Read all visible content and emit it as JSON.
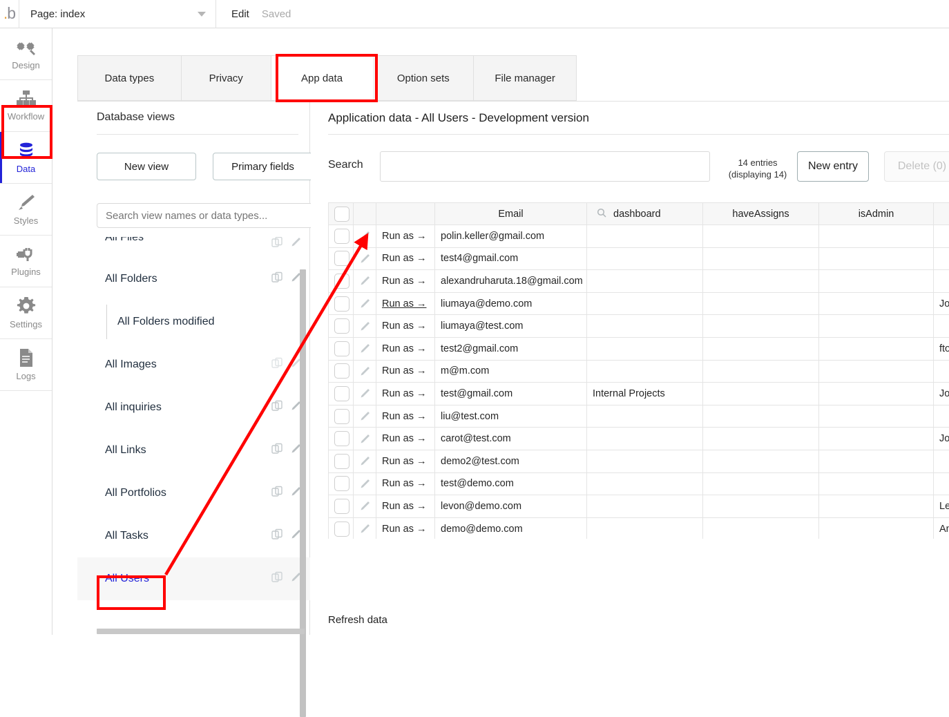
{
  "topbar": {
    "logo": "bubble-logo",
    "page_label": "Page: index",
    "edit_label": "Edit",
    "saved_label": "Saved"
  },
  "rail": {
    "items": [
      {
        "label": "Design",
        "icon": "design-icon",
        "active": false
      },
      {
        "label": "Workflow",
        "icon": "workflow-icon",
        "active": false
      },
      {
        "label": "Data",
        "icon": "database-icon",
        "active": true
      },
      {
        "label": "Styles",
        "icon": "brush-icon",
        "active": false
      },
      {
        "label": "Plugins",
        "icon": "plugin-icon",
        "active": false
      },
      {
        "label": "Settings",
        "icon": "gear-icon",
        "active": false
      },
      {
        "label": "Logs",
        "icon": "document-icon",
        "active": false
      }
    ]
  },
  "tabs": [
    {
      "label": "Data types",
      "active": false
    },
    {
      "label": "Privacy",
      "active": false
    },
    {
      "label": "App data",
      "active": true
    },
    {
      "label": "Option sets",
      "active": false
    },
    {
      "label": "File manager",
      "active": false
    }
  ],
  "left_panel": {
    "title": "Database views",
    "new_view_label": "New view",
    "primary_fields_label": "Primary fields",
    "search_placeholder": "Search view names or data types...",
    "views": [
      {
        "name": "All Files",
        "child": false,
        "selected": false
      },
      {
        "name": "All Folders",
        "child": false,
        "selected": false
      },
      {
        "name": "All Folders modified",
        "child": true,
        "selected": false
      },
      {
        "name": "All Images",
        "child": false,
        "selected": false
      },
      {
        "name": "All inquiries",
        "child": false,
        "selected": false
      },
      {
        "name": "All Links",
        "child": false,
        "selected": false
      },
      {
        "name": "All Portfolios",
        "child": false,
        "selected": false
      },
      {
        "name": "All Tasks",
        "child": false,
        "selected": false
      },
      {
        "name": "All Users",
        "child": false,
        "selected": true
      }
    ]
  },
  "main": {
    "title": "Application data - All Users - Development version",
    "search_label": "Search",
    "search_value": "",
    "search_placeholder": "",
    "entries_line1": "14 entries",
    "entries_line2": "(displaying 14)",
    "new_entry_label": "New entry",
    "delete_label": "Delete (0)",
    "refresh_label": "Refresh data"
  },
  "table": {
    "columns": [
      "",
      "",
      "",
      "Email",
      "dashboard",
      "haveAssigns",
      "isAdmin",
      ""
    ],
    "dashboard_search_icon": "search-icon",
    "run_as_label": "Run as →",
    "rows": [
      {
        "email": "polin.keller@gmail.com",
        "dashboard": "",
        "haveAssigns": "",
        "isAdmin": "",
        "next": "",
        "underlined": false
      },
      {
        "email": "test4@gmail.com",
        "dashboard": "",
        "haveAssigns": "",
        "isAdmin": "",
        "next": "",
        "underlined": false
      },
      {
        "email": "alexandruharuta.18@gmail.com",
        "dashboard": "",
        "haveAssigns": "",
        "isAdmin": "",
        "next": "",
        "underlined": false
      },
      {
        "email": "liumaya@demo.com",
        "dashboard": "",
        "haveAssigns": "",
        "isAdmin": "",
        "next": "Jo",
        "underlined": true
      },
      {
        "email": "liumaya@test.com",
        "dashboard": "",
        "haveAssigns": "",
        "isAdmin": "",
        "next": "",
        "underlined": false
      },
      {
        "email": "test2@gmail.com",
        "dashboard": "",
        "haveAssigns": "",
        "isAdmin": "",
        "next": "fto",
        "underlined": false
      },
      {
        "email": "m@m.com",
        "dashboard": "",
        "haveAssigns": "",
        "isAdmin": "",
        "next": "",
        "underlined": false
      },
      {
        "email": "test@gmail.com",
        "dashboard": "Internal Projects",
        "haveAssigns": "",
        "isAdmin": "",
        "next": "Jo",
        "underlined": false
      },
      {
        "email": "liu@test.com",
        "dashboard": "",
        "haveAssigns": "",
        "isAdmin": "",
        "next": "",
        "underlined": false
      },
      {
        "email": "carot@test.com",
        "dashboard": "",
        "haveAssigns": "",
        "isAdmin": "",
        "next": "Jo",
        "underlined": false
      },
      {
        "email": "demo2@test.com",
        "dashboard": "",
        "haveAssigns": "",
        "isAdmin": "",
        "next": "",
        "underlined": false
      },
      {
        "email": "test@demo.com",
        "dashboard": "",
        "haveAssigns": "",
        "isAdmin": "",
        "next": "",
        "underlined": false
      },
      {
        "email": "levon@demo.com",
        "dashboard": "",
        "haveAssigns": "",
        "isAdmin": "",
        "next": "Le",
        "underlined": false
      },
      {
        "email": "demo@demo.com",
        "dashboard": "",
        "haveAssigns": "",
        "isAdmin": "",
        "next": "An",
        "underlined": false
      }
    ]
  },
  "annotations": {
    "color": "#ff0000",
    "boxes": [
      "data-rail-item",
      "app-data-tab",
      "all-users-view"
    ],
    "arrow": "from All Users view to first row edit pencil"
  },
  "colors": {
    "accent_blue": "#2323d8",
    "annotation_red": "#ff0000",
    "border": "#e0e0e0",
    "tab_inactive_bg": "#f4f4f4"
  }
}
